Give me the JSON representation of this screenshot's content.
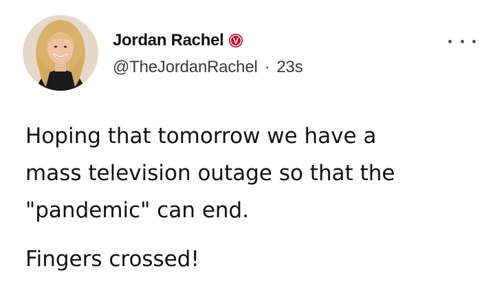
{
  "tweet": {
    "author": {
      "display_name": "Jordan Rachel",
      "handle": "@TheJordanRachel",
      "separator": "·",
      "time": "23s",
      "verified_badge": "V",
      "verified_color": "#c8102e"
    },
    "body_lines": [
      "Hoping that tomorrow we have a",
      "mass television outage so that the",
      "\"pandemic\" can end."
    ],
    "body_second_paragraph": "Fingers crossed!",
    "more_icon": "ellipsis-icon"
  }
}
